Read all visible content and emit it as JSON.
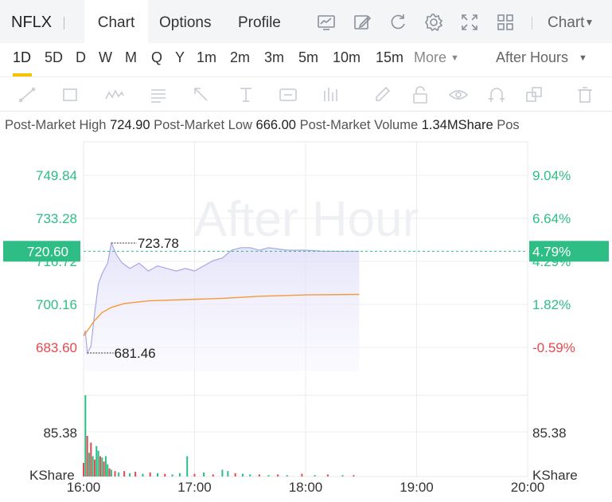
{
  "header": {
    "ticker": "NFLX",
    "tabs": [
      "Chart",
      "Options",
      "Profile"
    ],
    "active_tab": "Chart",
    "chart_type_label": "Chart"
  },
  "intervals": {
    "items": [
      "1D",
      "5D",
      "D",
      "W",
      "M",
      "Q",
      "Y",
      "1m",
      "2m",
      "3m",
      "5m",
      "10m",
      "15m"
    ],
    "active": "1D",
    "more_label": "More",
    "session_label": "After Hours"
  },
  "stats": {
    "high_label": "Post-Market High",
    "high_value": "724.90",
    "low_label": "Post-Market Low",
    "low_value": "666.00",
    "volume_label": "Post-Market Volume",
    "volume_value": "1.34MShare",
    "trailing": "Pos"
  },
  "colors": {
    "up": "#2ebd85",
    "down": "#e5484d",
    "price_line": "#a9a6e8",
    "avg_line": "#f39b3c",
    "yellow_accent": "#f5c400"
  },
  "chart_data": {
    "type": "line",
    "watermark": "After Hour",
    "x_ticks": [
      "16:00",
      "17:00",
      "18:00",
      "19:00",
      "20:00"
    ],
    "y_left_ticks": [
      "749.84",
      "733.28",
      "716.72",
      "700.16",
      "683.60"
    ],
    "y_right_ticks": [
      "9.04%",
      "6.64%",
      "4.29%",
      "1.82%",
      "-0.59%"
    ],
    "current_price": "720.60",
    "current_change": "4.79%",
    "high_marker": "723.78",
    "low_marker": "681.46",
    "ylim": [
      683.6,
      749.84
    ],
    "volume_axis_value": "85.38",
    "volume_unit": "KShare",
    "price_series": [
      {
        "t": 0,
        "v": 688
      },
      {
        "t": 1,
        "v": 690
      },
      {
        "t": 2,
        "v": 681.46
      },
      {
        "t": 4,
        "v": 684
      },
      {
        "t": 6,
        "v": 697
      },
      {
        "t": 8,
        "v": 708
      },
      {
        "t": 10,
        "v": 712
      },
      {
        "t": 13,
        "v": 716
      },
      {
        "t": 15,
        "v": 723.78
      },
      {
        "t": 18,
        "v": 719
      },
      {
        "t": 21,
        "v": 716
      },
      {
        "t": 25,
        "v": 714
      },
      {
        "t": 30,
        "v": 716
      },
      {
        "t": 35,
        "v": 713
      },
      {
        "t": 40,
        "v": 715
      },
      {
        "t": 45,
        "v": 714
      },
      {
        "t": 50,
        "v": 713
      },
      {
        "t": 55,
        "v": 714
      },
      {
        "t": 60,
        "v": 713
      },
      {
        "t": 65,
        "v": 715
      },
      {
        "t": 70,
        "v": 717
      },
      {
        "t": 75,
        "v": 718
      },
      {
        "t": 80,
        "v": 721
      },
      {
        "t": 85,
        "v": 722
      },
      {
        "t": 90,
        "v": 722
      },
      {
        "t": 95,
        "v": 721
      },
      {
        "t": 100,
        "v": 722
      },
      {
        "t": 110,
        "v": 721
      },
      {
        "t": 120,
        "v": 721
      },
      {
        "t": 130,
        "v": 720.6
      },
      {
        "t": 149,
        "v": 720.6
      }
    ],
    "avg_series": [
      {
        "t": 0,
        "v": 688
      },
      {
        "t": 3,
        "v": 691
      },
      {
        "t": 6,
        "v": 694
      },
      {
        "t": 10,
        "v": 697
      },
      {
        "t": 15,
        "v": 699
      },
      {
        "t": 22,
        "v": 700.5
      },
      {
        "t": 35,
        "v": 701.5
      },
      {
        "t": 55,
        "v": 702
      },
      {
        "t": 75,
        "v": 702.5
      },
      {
        "t": 95,
        "v": 703.3
      },
      {
        "t": 120,
        "v": 703.8
      },
      {
        "t": 149,
        "v": 704
      }
    ],
    "volume_bars": [
      {
        "t": 0,
        "v": 20,
        "up": false
      },
      {
        "t": 1,
        "v": 120,
        "up": true
      },
      {
        "t": 2,
        "v": 60,
        "up": false
      },
      {
        "t": 3,
        "v": 35,
        "up": true
      },
      {
        "t": 4,
        "v": 50,
        "up": false
      },
      {
        "t": 5,
        "v": 30,
        "up": true
      },
      {
        "t": 6,
        "v": 25,
        "up": false
      },
      {
        "t": 7,
        "v": 45,
        "up": true
      },
      {
        "t": 8,
        "v": 38,
        "up": true
      },
      {
        "t": 9,
        "v": 30,
        "up": false
      },
      {
        "t": 10,
        "v": 28,
        "up": true
      },
      {
        "t": 11,
        "v": 22,
        "up": false
      },
      {
        "t": 12,
        "v": 30,
        "up": true
      },
      {
        "t": 13,
        "v": 18,
        "up": true
      },
      {
        "t": 14,
        "v": 12,
        "up": false
      },
      {
        "t": 15,
        "v": 10,
        "up": true
      },
      {
        "t": 17,
        "v": 8,
        "up": false
      },
      {
        "t": 19,
        "v": 6,
        "up": true
      },
      {
        "t": 22,
        "v": 8,
        "up": false
      },
      {
        "t": 25,
        "v": 5,
        "up": true
      },
      {
        "t": 28,
        "v": 7,
        "up": false
      },
      {
        "t": 32,
        "v": 4,
        "up": true
      },
      {
        "t": 36,
        "v": 6,
        "up": false
      },
      {
        "t": 40,
        "v": 5,
        "up": true
      },
      {
        "t": 44,
        "v": 4,
        "up": false
      },
      {
        "t": 48,
        "v": 3,
        "up": true
      },
      {
        "t": 52,
        "v": 5,
        "up": true
      },
      {
        "t": 56,
        "v": 30,
        "up": true
      },
      {
        "t": 60,
        "v": 4,
        "up": false
      },
      {
        "t": 65,
        "v": 6,
        "up": true
      },
      {
        "t": 70,
        "v": 3,
        "up": false
      },
      {
        "t": 75,
        "v": 10,
        "up": true
      },
      {
        "t": 78,
        "v": 8,
        "up": true
      },
      {
        "t": 82,
        "v": 5,
        "up": false
      },
      {
        "t": 86,
        "v": 4,
        "up": true
      },
      {
        "t": 90,
        "v": 3,
        "up": true
      },
      {
        "t": 95,
        "v": 3,
        "up": false
      },
      {
        "t": 100,
        "v": 2,
        "up": true
      },
      {
        "t": 105,
        "v": 3,
        "up": false
      },
      {
        "t": 110,
        "v": 2,
        "up": true
      },
      {
        "t": 118,
        "v": 4,
        "up": false
      },
      {
        "t": 125,
        "v": 2,
        "up": true
      },
      {
        "t": 132,
        "v": 3,
        "up": false
      },
      {
        "t": 140,
        "v": 2,
        "up": true
      },
      {
        "t": 146,
        "v": 2,
        "up": false
      }
    ],
    "volume_max": 120
  }
}
